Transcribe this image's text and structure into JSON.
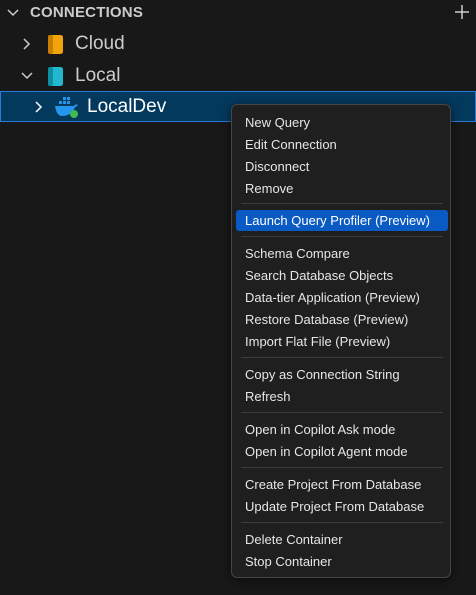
{
  "section": {
    "title": "CONNECTIONS",
    "chevron_icon": "chevron-down-icon",
    "add_icon": "plus-icon"
  },
  "tree": {
    "items": [
      {
        "label": "Cloud",
        "expanded": false,
        "icon": "database-icon",
        "icon_color": "#f0a30a"
      },
      {
        "label": "Local",
        "expanded": true,
        "icon": "database-icon",
        "icon_color": "#22b8cf"
      },
      {
        "label": "LocalDev",
        "expanded": false,
        "selected": true,
        "icon": "docker-icon",
        "icon_color": "#2496ed",
        "status_color": "#3fb950"
      }
    ]
  },
  "context_menu": {
    "groups": [
      [
        "New Query",
        "Edit Connection",
        "Disconnect",
        "Remove"
      ],
      [
        "Launch Query Profiler (Preview)"
      ],
      [
        "Schema Compare",
        "Search Database Objects",
        "Data-tier Application (Preview)",
        "Restore Database (Preview)",
        "Import Flat File (Preview)"
      ],
      [
        "Copy as Connection String",
        "Refresh"
      ],
      [
        "Open in Copilot Ask mode",
        "Open in Copilot Agent mode"
      ],
      [
        "Create Project From Database",
        "Update Project From Database"
      ],
      [
        "Delete Container",
        "Stop Container"
      ]
    ],
    "active_item": "Launch Query Profiler (Preview)"
  },
  "colors": {
    "background": "#181818",
    "selection_bg": "#04395e",
    "selection_border": "#2b79d8",
    "menu_bg": "#1f1f1f",
    "menu_active": "#0a5ac4"
  }
}
